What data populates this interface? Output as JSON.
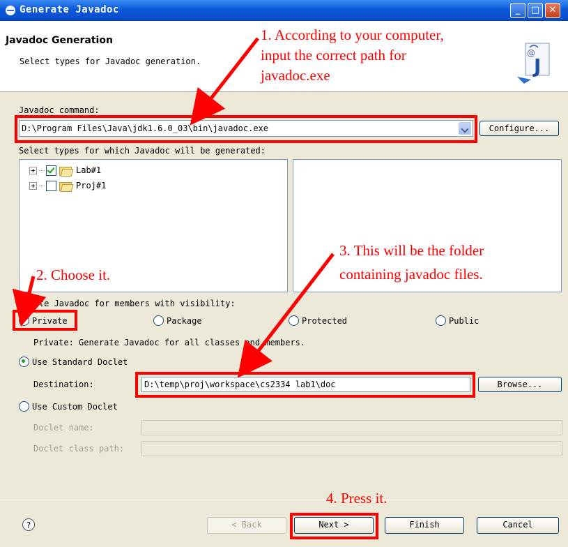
{
  "window": {
    "title": "Generate Javadoc",
    "minimize": "_",
    "maximize": "□",
    "close": "X"
  },
  "header": {
    "title": "Javadoc Generation",
    "subtitle": "Select types for Javadoc generation.",
    "icon": "javadoc-wizard-icon"
  },
  "javadoc_command": {
    "label": "Javadoc command:",
    "value": "D:\\Program Files\\Java\\jdk1.6.0_03\\bin\\javadoc.exe",
    "configure_button": "Configure..."
  },
  "types": {
    "label": "Select types for which Javadoc will be generated:",
    "tree": [
      {
        "name": "Lab#1",
        "checked": true
      },
      {
        "name": "Proj#1",
        "checked": false
      }
    ]
  },
  "visibility": {
    "label": "Create Javadoc for members with visibility:",
    "options": [
      "Private",
      "Package",
      "Protected",
      "Public"
    ],
    "selected": "Private",
    "description": "Private: Generate Javadoc for all classes and members."
  },
  "standard_doclet": {
    "label": "Use Standard Doclet",
    "selected": true,
    "destination_label": "Destination:",
    "destination_value": "D:\\temp\\proj\\workspace\\cs2334 lab1\\doc",
    "browse_button": "Browse..."
  },
  "custom_doclet": {
    "label": "Use Custom Doclet",
    "selected": false,
    "name_label": "Doclet name:",
    "classpath_label": "Doclet class path:"
  },
  "footer": {
    "help": "?",
    "back": "< Back",
    "next": "Next >",
    "finish": "Finish",
    "cancel": "Cancel"
  },
  "annotations": {
    "a1_line1": "1. According to your computer,",
    "a1_line2": "input the correct path for",
    "a1_line3": "javadoc.exe",
    "a2": "2. Choose it.",
    "a3_line1": "3. This will be the folder",
    "a3_line2": "containing javadoc files.",
    "a4": "4. Press it.",
    "color": "#ff0000"
  }
}
